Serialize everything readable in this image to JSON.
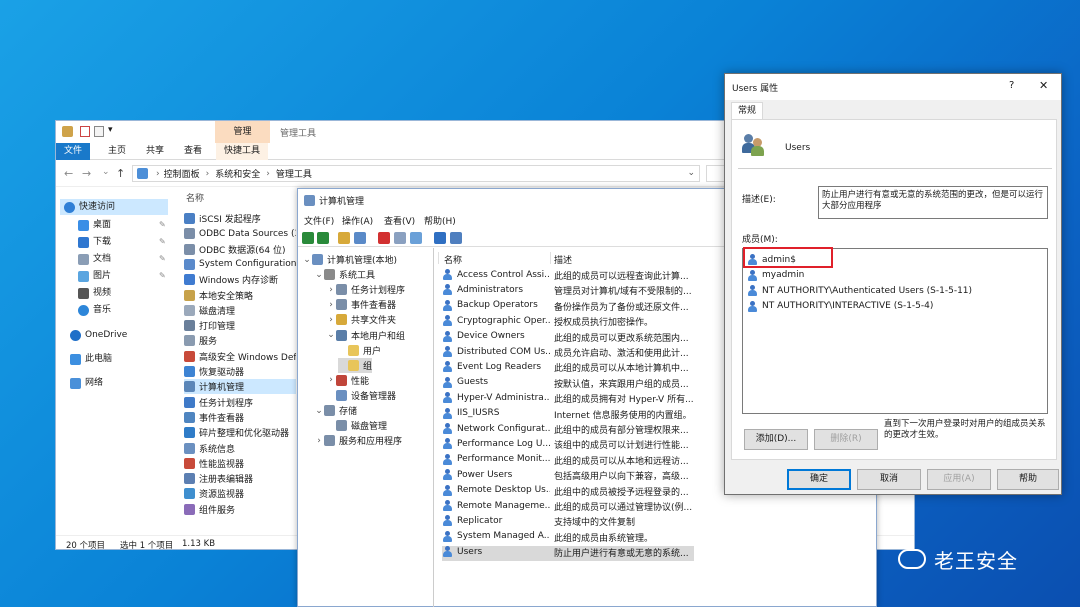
{
  "explorer": {
    "ribbon_context_tab": "管理",
    "ribbon_context_title": "管理工具",
    "tabs": [
      "文件",
      "主页",
      "共享",
      "查看",
      "快捷工具"
    ],
    "breadcrumb": [
      "控制面板",
      "系统和安全",
      "管理工具"
    ],
    "column_name": "名称",
    "nav": [
      {
        "label": "快速访问",
        "icon": "star-icon"
      },
      {
        "label": "桌面",
        "icon": "desktop-icon"
      },
      {
        "label": "下载",
        "icon": "download-icon"
      },
      {
        "label": "文档",
        "icon": "document-icon"
      },
      {
        "label": "图片",
        "icon": "picture-icon"
      },
      {
        "label": "视频",
        "icon": "video-icon"
      },
      {
        "label": "音乐",
        "icon": "music-icon"
      },
      {
        "label": "OneDrive",
        "icon": "cloud-icon"
      },
      {
        "label": "此电脑",
        "icon": "computer-icon"
      },
      {
        "label": "网络",
        "icon": "network-icon"
      }
    ],
    "files": [
      "iSCSI 发起程序",
      "ODBC Data Sources (3",
      "ODBC 数据源(64 位)",
      "System Configuration",
      "Windows 内存诊断",
      "本地安全策略",
      "磁盘清理",
      "打印管理",
      "服务",
      "高级安全 Windows Defe",
      "恢复驱动器",
      "计算机管理",
      "任务计划程序",
      "事件查看器",
      "碎片整理和优化驱动器",
      "系统信息",
      "性能监视器",
      "注册表编辑器",
      "资源监视器",
      "组件服务"
    ],
    "status": {
      "count": "20 个项目",
      "selected": "选中 1 个项目",
      "size": "1.13 KB"
    }
  },
  "cm": {
    "title": "计算机管理",
    "menu": [
      "文件(F)",
      "操作(A)",
      "查看(V)",
      "帮助(H)"
    ],
    "tree": [
      {
        "label": "计算机管理(本地)",
        "indent": 0,
        "expander": "⌄"
      },
      {
        "label": "系统工具",
        "indent": 1,
        "expander": "⌄"
      },
      {
        "label": "任务计划程序",
        "indent": 2,
        "expander": "›"
      },
      {
        "label": "事件查看器",
        "indent": 2,
        "expander": "›"
      },
      {
        "label": "共享文件夹",
        "indent": 2,
        "expander": "›"
      },
      {
        "label": "本地用户和组",
        "indent": 2,
        "expander": "⌄"
      },
      {
        "label": "用户",
        "indent": 3,
        "expander": ""
      },
      {
        "label": "组",
        "indent": 3,
        "expander": ""
      },
      {
        "label": "性能",
        "indent": 2,
        "expander": "›"
      },
      {
        "label": "设备管理器",
        "indent": 2,
        "expander": ""
      },
      {
        "label": "存储",
        "indent": 1,
        "expander": "⌄"
      },
      {
        "label": "磁盘管理",
        "indent": 2,
        "expander": ""
      },
      {
        "label": "服务和应用程序",
        "indent": 1,
        "expander": "›"
      }
    ],
    "col_name": "名称",
    "col_desc": "描述",
    "groups": [
      {
        "name": "Access Control Assi...",
        "desc": "此组的成员可以远程查询此计算..."
      },
      {
        "name": "Administrators",
        "desc": "管理员对计算机/域有不受限制的..."
      },
      {
        "name": "Backup Operators",
        "desc": "备份操作员为了备份或还原文件..."
      },
      {
        "name": "Cryptographic Oper...",
        "desc": "授权成员执行加密操作。"
      },
      {
        "name": "Device Owners",
        "desc": "此组的成员可以更改系统范围内..."
      },
      {
        "name": "Distributed COM Us...",
        "desc": "成员允许启动、激活和使用此计..."
      },
      {
        "name": "Event Log Readers",
        "desc": "此组的成员可以从本地计算机中..."
      },
      {
        "name": "Guests",
        "desc": "按默认值，来宾跟用户组的成员..."
      },
      {
        "name": "Hyper-V Administra...",
        "desc": "此组的成员拥有对 Hyper-V 所有..."
      },
      {
        "name": "IIS_IUSRS",
        "desc": "Internet 信息服务使用的内置组。"
      },
      {
        "name": "Network Configurat...",
        "desc": "此组中的成员有部分管理权限来..."
      },
      {
        "name": "Performance Log U...",
        "desc": "该组中的成员可以计划进行性能..."
      },
      {
        "name": "Performance Monit...",
        "desc": "此组的成员可以从本地和远程访..."
      },
      {
        "name": "Power Users",
        "desc": "包括高级用户以向下兼容，高级..."
      },
      {
        "name": "Remote Desktop Us...",
        "desc": "此组中的成员被授予远程登录的..."
      },
      {
        "name": "Remote Manageme...",
        "desc": "此组的成员可以通过管理协议(例..."
      },
      {
        "name": "Replicator",
        "desc": "支持域中的文件复制"
      },
      {
        "name": "System Managed A...",
        "desc": "此组的成员由系统管理。"
      },
      {
        "name": "Users",
        "desc": "防止用户进行有意或无意的系统..."
      }
    ]
  },
  "dialog": {
    "title": "Users 属性",
    "help_glyph": "?",
    "close_glyph": "✕",
    "tab": "常规",
    "group_name": "Users",
    "desc_label": "描述(E):",
    "desc_value": "防止用户进行有意或无意的系统范围的更改，但是可以运行大部分应用程序",
    "members_label": "成员(M):",
    "members": [
      "admin$",
      "myadmin",
      "NT AUTHORITY\\Authenticated Users (S-1-5-11)",
      "NT AUTHORITY\\INTERACTIVE (S-1-5-4)"
    ],
    "add_button": "添加(D)...",
    "remove_button": "删除(R)",
    "note": "直到下一次用户登录时对用户的组成员关系的更改才生效。",
    "ok": "确定",
    "cancel": "取消",
    "apply": "应用(A)",
    "help": "帮助",
    "highlight_color": "#e0202a"
  },
  "watermark": "老王安全"
}
